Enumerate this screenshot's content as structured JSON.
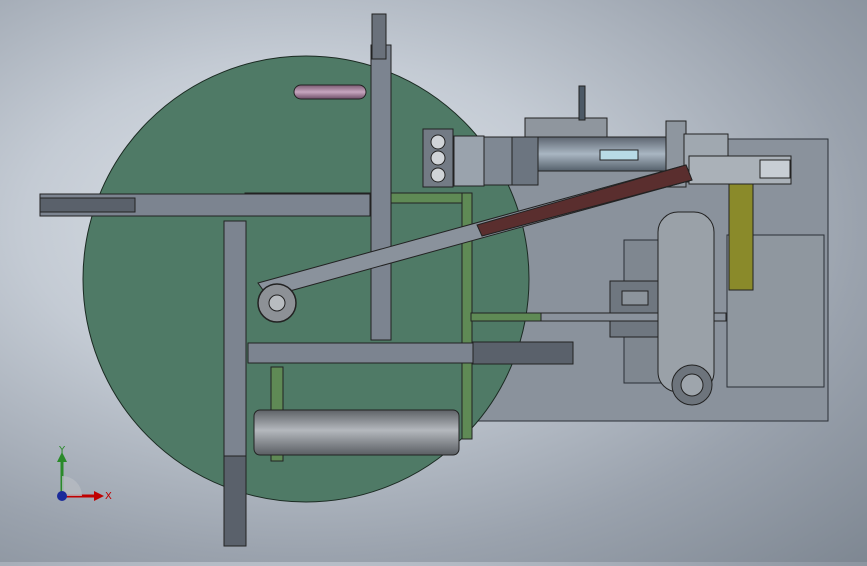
{
  "viewport": {
    "background_top": "#dfe4ea",
    "background_bottom": "#7e8792",
    "turntable_color": "#4f7a66",
    "plate_color": "#8a929c",
    "arm_color": "#7c8490",
    "frame_color": "#5f8a55",
    "belt_color": "#5a2e2e",
    "bracket_color": "#8a8a2a",
    "roller_color": "#8d9196"
  },
  "triad": {
    "x_label": "X",
    "y_label": "Y",
    "x_color": "#c00000",
    "y_color": "#2a8a2a",
    "origin_color": "#1a2a9a"
  }
}
